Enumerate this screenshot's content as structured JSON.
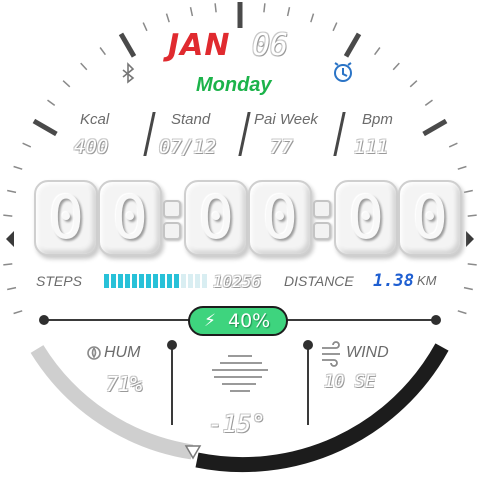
{
  "date": {
    "month": "JAN",
    "day": "06",
    "weekday": "Monday"
  },
  "icons": {
    "left_status": "bluetooth-icon",
    "right_status": "alarm-clock-icon"
  },
  "stats": [
    {
      "label": "Kcal",
      "value": "400"
    },
    {
      "label": "Stand",
      "value": "07/12"
    },
    {
      "label": "Pai Week",
      "value": "77"
    },
    {
      "label": "Bpm",
      "value": "111"
    }
  ],
  "time": {
    "hh": "00",
    "mm": "00",
    "ss": "00"
  },
  "steps": {
    "label": "STEPS",
    "value": "10256",
    "progress": 0.75
  },
  "distance": {
    "label": "DISTANCE",
    "value": "1.38",
    "unit": "KM"
  },
  "battery": {
    "text": "40%",
    "level": 0.4
  },
  "humidity": {
    "label": "HUM",
    "value": "71%"
  },
  "wind": {
    "label": "WIND",
    "value": "10 SE"
  },
  "temperature": {
    "value": "-15°"
  },
  "colors": {
    "accent_red": "#e02a2f",
    "weekday_green": "#1cb34a",
    "steps_cyan": "#28c1d8",
    "distance_blue": "#1f5fd1",
    "battery_green": "#36d27a",
    "alarm_blue": "#2b74c6"
  }
}
